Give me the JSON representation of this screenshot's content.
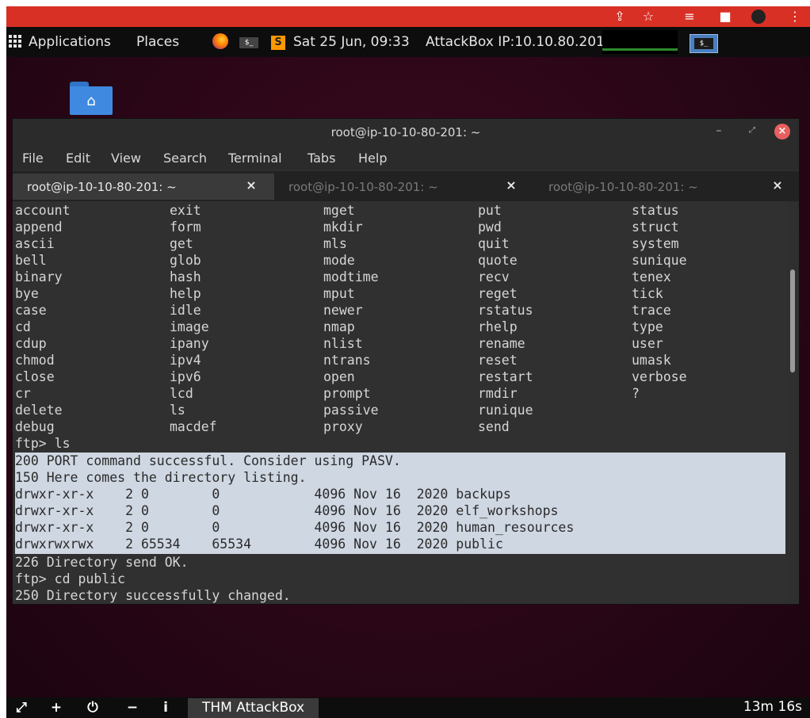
{
  "panel": {
    "applications": "Applications",
    "places": "Places",
    "clock": "Sat 25 Jun, 09:33",
    "attackbox_ip": "AttackBox IP:10.10.80.201"
  },
  "window": {
    "title": "root@ip-10-10-80-201: ~",
    "menu": [
      "File",
      "Edit",
      "View",
      "Search",
      "Terminal",
      "Tabs",
      "Help"
    ],
    "tabs": [
      {
        "label": "root@ip-10-10-80-201: ~",
        "active": true
      },
      {
        "label": "root@ip-10-10-80-201: ~",
        "active": false
      },
      {
        "label": "root@ip-10-10-80-201: ~",
        "active": false
      }
    ]
  },
  "terminal": {
    "commands": [
      [
        "account",
        "exit",
        "mget",
        "put",
        "status"
      ],
      [
        "append",
        "form",
        "mkdir",
        "pwd",
        "struct"
      ],
      [
        "ascii",
        "get",
        "mls",
        "quit",
        "system"
      ],
      [
        "bell",
        "glob",
        "mode",
        "quote",
        "sunique"
      ],
      [
        "binary",
        "hash",
        "modtime",
        "recv",
        "tenex"
      ],
      [
        "bye",
        "help",
        "mput",
        "reget",
        "tick"
      ],
      [
        "case",
        "idle",
        "newer",
        "rstatus",
        "trace"
      ],
      [
        "cd",
        "image",
        "nmap",
        "rhelp",
        "type"
      ],
      [
        "cdup",
        "ipany",
        "nlist",
        "rename",
        "user"
      ],
      [
        "chmod",
        "ipv4",
        "ntrans",
        "reset",
        "umask"
      ],
      [
        "close",
        "ipv6",
        "open",
        "restart",
        "verbose"
      ],
      [
        "cr",
        "lcd",
        "prompt",
        "rmdir",
        "?"
      ],
      [
        "delete",
        "ls",
        "passive",
        "runique",
        ""
      ],
      [
        "debug",
        "macdef",
        "proxy",
        "send",
        ""
      ]
    ],
    "prompt_ls": "ftp> ls",
    "selected_lines": [
      "200 PORT command successful. Consider using PASV.",
      "150 Here comes the directory listing.",
      "drwxr-xr-x    2 0        0            4096 Nov 16  2020 backups",
      "drwxr-xr-x    2 0        0            4096 Nov 16  2020 elf_workshops",
      "drwxr-xr-x    2 0        0            4096 Nov 16  2020 human_resources",
      "drwxrwxrwx    2 65534    65534        4096 Nov 16  2020 public"
    ],
    "after_lines": [
      "226 Directory send OK.",
      "ftp> cd public",
      "250 Directory successfully changed."
    ]
  },
  "dock": {
    "task_label": "THM AttackBox",
    "timer": "13m 16s"
  }
}
